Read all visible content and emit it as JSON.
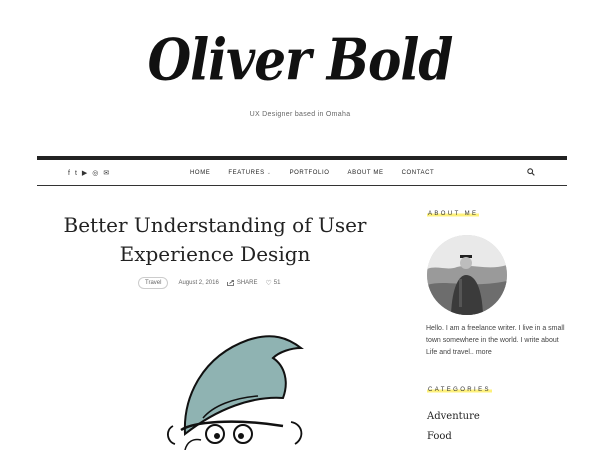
{
  "site": {
    "logo": "Oliver Bold",
    "tagline": "UX Designer based in Omaha"
  },
  "social": {
    "icons": [
      {
        "name": "facebook-icon",
        "glyph": "f"
      },
      {
        "name": "twitter-icon",
        "glyph": "t"
      },
      {
        "name": "youtube-icon",
        "glyph": "▶"
      },
      {
        "name": "instagram-icon",
        "glyph": "◎"
      },
      {
        "name": "email-icon",
        "glyph": "✉"
      }
    ]
  },
  "nav": {
    "items": [
      {
        "label": "HOME"
      },
      {
        "label": "FEATURES"
      },
      {
        "label": "PORTFOLIO"
      },
      {
        "label": "ABOUT ME"
      },
      {
        "label": "CONTACT"
      }
    ]
  },
  "post": {
    "title": "Better Understanding of User Experience Design",
    "tag": "Travel",
    "date": "August 2, 2016",
    "share_label": "SHARE",
    "likes": "51"
  },
  "sidebar": {
    "about_heading": "ABOUT ME",
    "about_text": "Hello. I am a freelance writer. I live in a small town somewhere in the world. I write about Life and travel.. ",
    "about_more": "more",
    "categories_heading": "CATEGORIES",
    "categories": [
      {
        "label": "Adventure"
      },
      {
        "label": "Food"
      }
    ]
  },
  "colors": {
    "highlight": "#fdf07a",
    "nav_border": "#222222"
  }
}
